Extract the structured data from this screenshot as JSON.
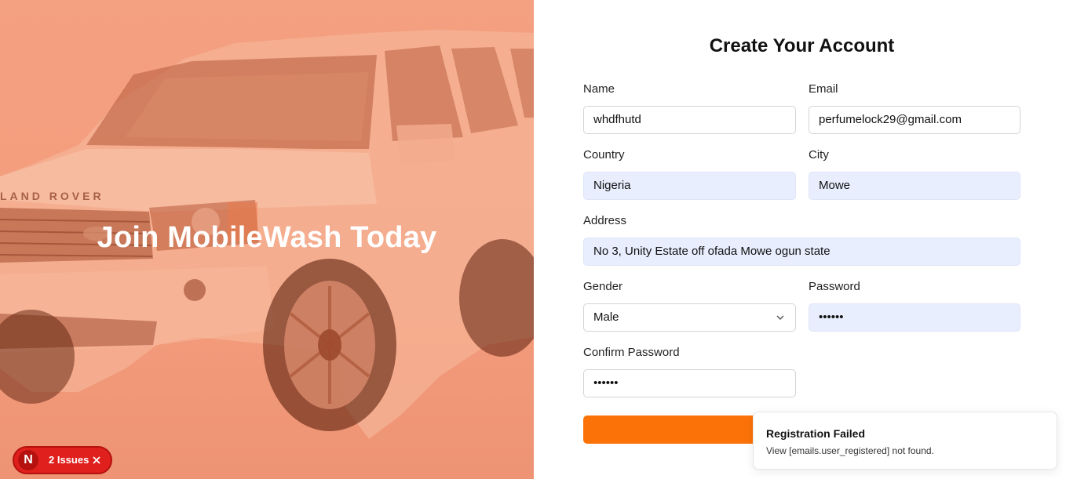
{
  "hero": {
    "title": "Join MobileWash Today"
  },
  "form": {
    "title": "Create Your Account",
    "fields": {
      "name": {
        "label": "Name",
        "value": "whdfhutd"
      },
      "email": {
        "label": "Email",
        "value": "perfumelock29@gmail.com"
      },
      "country": {
        "label": "Country",
        "value": "Nigeria"
      },
      "city": {
        "label": "City",
        "value": "Mowe"
      },
      "address": {
        "label": "Address",
        "value": "No 3, Unity Estate off ofada Mowe ogun state"
      },
      "gender": {
        "label": "Gender",
        "value": "Male"
      },
      "password": {
        "label": "Password",
        "value": "••••••"
      },
      "confirm_password": {
        "label": "Confirm Password",
        "value": "••••••"
      }
    },
    "submit_color": "#fb7208"
  },
  "toast": {
    "title": "Registration Failed",
    "message": "View [emails.user_registered] not found."
  },
  "issues_badge": {
    "logo": "N",
    "label": "2 Issues",
    "close_icon": "close-icon"
  },
  "colors": {
    "accent": "#fb7208",
    "hero_overlay": "#f4a181",
    "error_badge": "#e0201d"
  }
}
